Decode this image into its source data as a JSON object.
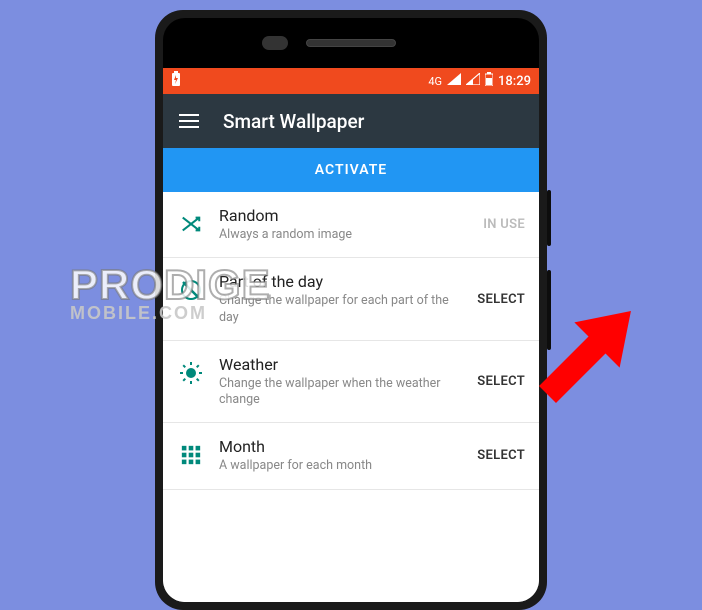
{
  "statusbar": {
    "network_label": "4G",
    "time": "18:29"
  },
  "appbar": {
    "title": "Smart Wallpaper"
  },
  "activate_label": "ACTIVATE",
  "rows": [
    {
      "title": "Random",
      "sub": "Always a random image",
      "action": "IN USE"
    },
    {
      "title": "Part of the day",
      "sub": "Change the wallpaper for each part of the day",
      "action": "SELECT"
    },
    {
      "title": "Weather",
      "sub": "Change the wallpaper when the weather change",
      "action": "SELECT"
    },
    {
      "title": "Month",
      "sub": "A wallpaper for each month",
      "action": "SELECT"
    }
  ],
  "watermark": {
    "line1": "PRODIGE",
    "line2": "MOBILE.COM"
  }
}
